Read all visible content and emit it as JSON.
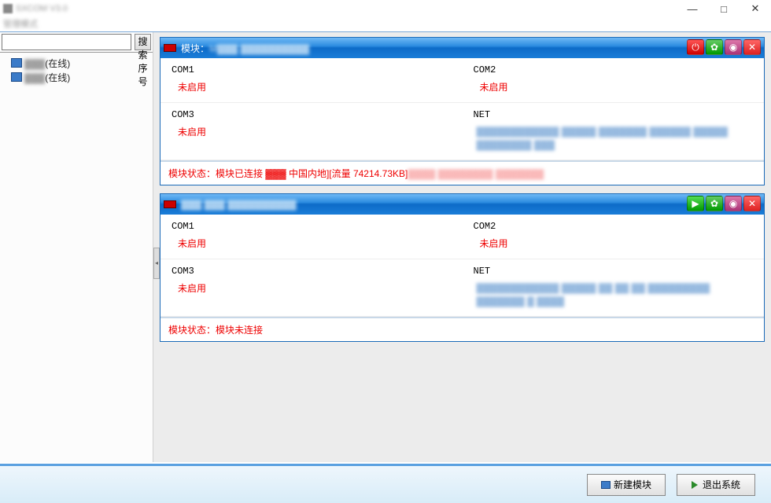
{
  "window": {
    "title": "SXCOM V3.0",
    "menu": "管理模式"
  },
  "sidebar": {
    "search_placeholder": "",
    "search_btn": "搜索序号",
    "items": [
      {
        "id": "▓▓▓",
        "suffix": "(在线)"
      },
      {
        "id": "▓▓▓",
        "suffix": "(在线)"
      }
    ]
  },
  "modules": [
    {
      "title_prefix": "模块：",
      "title_id": "M▓▓▓ ▓▓▓▓▓▓▓▓▓▓",
      "header_led": "red",
      "buttons": [
        "power",
        "gear",
        "globe",
        "close"
      ],
      "ports": {
        "com1": {
          "name": "COM1",
          "status": "未启用"
        },
        "com2": {
          "name": "COM2",
          "status": "未启用"
        },
        "com3": {
          "name": "COM3",
          "status": "未启用"
        },
        "net": {
          "name": "NET",
          "info": "▓▓▓▓▓▓▓▓▓▓▓▓ ▓▓▓▓▓ ▓▓▓▓▓▓▓ ▓▓▓▓▓▓\n▓▓▓▓▓ ▓▓▓▓▓▓▓▓ ▓▓▓"
        }
      },
      "footer_prefix": "模块状态：模块已连接",
      "footer_mid": "▓▓▓ 中国内地][流量 74214.73KB]",
      "footer_tail": "▓▓▓▓ ▓▓▓▓▓▓▓▓ ▓▓▓▓▓▓▓"
    },
    {
      "title_prefix": "",
      "title_id": "▓▓▓ ▓▓▓ ▓▓▓▓▓▓▓▓▓▓",
      "header_led": "red",
      "buttons": [
        "play",
        "gear",
        "globe",
        "close"
      ],
      "ports": {
        "com1": {
          "name": "COM1",
          "status": "未启用"
        },
        "com2": {
          "name": "COM2",
          "status": "未启用"
        },
        "com3": {
          "name": "COM3",
          "status": "未启用"
        },
        "net": {
          "name": "NET",
          "info": "▓▓▓▓▓▓▓▓▓▓▓▓ ▓▓▓▓▓ ▓▓ ▓▓ ▓▓ ▓▓▓▓▓▓▓▓▓\n▓▓▓▓▓▓▓ ▓ ▓▓▓▓"
        }
      },
      "footer_prefix": "模块状态：模块未连接",
      "footer_mid": "",
      "footer_tail": ""
    }
  ],
  "bottombar": {
    "new_module": "新建模块",
    "exit_system": "退出系统"
  }
}
